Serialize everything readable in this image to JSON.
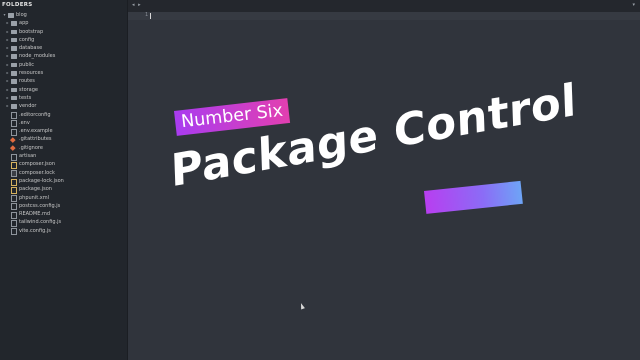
{
  "sidebar": {
    "title": "FOLDERS",
    "items": [
      {
        "label": "blog",
        "type": "folder",
        "arrow": "▾",
        "depth": 0
      },
      {
        "label": "app",
        "type": "folder",
        "arrow": "▸",
        "depth": 1
      },
      {
        "label": "bootstrap",
        "type": "folder",
        "arrow": "▸",
        "depth": 1
      },
      {
        "label": "config",
        "type": "folder",
        "arrow": "▸",
        "depth": 1
      },
      {
        "label": "database",
        "type": "folder",
        "arrow": "▸",
        "depth": 1
      },
      {
        "label": "node_modules",
        "type": "folder",
        "arrow": "▸",
        "depth": 1
      },
      {
        "label": "public",
        "type": "folder",
        "arrow": "▸",
        "depth": 1
      },
      {
        "label": "resources",
        "type": "folder",
        "arrow": "▸",
        "depth": 1
      },
      {
        "label": "routes",
        "type": "folder",
        "arrow": "▸",
        "depth": 1
      },
      {
        "label": "storage",
        "type": "folder",
        "arrow": "▸",
        "depth": 1
      },
      {
        "label": "tests",
        "type": "folder",
        "arrow": "▸",
        "depth": 1
      },
      {
        "label": "vendor",
        "type": "folder",
        "arrow": "▸",
        "depth": 1
      },
      {
        "label": ".editorconfig",
        "type": "file",
        "depth": 1
      },
      {
        "label": ".env",
        "type": "file",
        "depth": 1
      },
      {
        "label": ".env.example",
        "type": "file",
        "depth": 1
      },
      {
        "label": ".gitattributes",
        "type": "git",
        "depth": 1
      },
      {
        "label": ".gitignore",
        "type": "git",
        "depth": 1
      },
      {
        "label": "artisan",
        "type": "file",
        "depth": 1
      },
      {
        "label": "composer.json",
        "type": "json",
        "depth": 1
      },
      {
        "label": "composer.lock",
        "type": "lock",
        "depth": 1
      },
      {
        "label": "package-lock.json",
        "type": "json",
        "depth": 1
      },
      {
        "label": "package.json",
        "type": "json",
        "depth": 1
      },
      {
        "label": "phpunit.xml",
        "type": "file",
        "depth": 1
      },
      {
        "label": "postcss.config.js",
        "type": "file",
        "depth": 1
      },
      {
        "label": "README.md",
        "type": "file",
        "depth": 1
      },
      {
        "label": "tailwind.config.js",
        "type": "file",
        "depth": 1
      },
      {
        "label": "vite.config.js",
        "type": "file",
        "depth": 1
      }
    ]
  },
  "editor": {
    "nav_arrows": "◂ ▸",
    "tab_end": "▾",
    "line_number": "1"
  },
  "promo": {
    "tag": "Number Six",
    "title": "Package Control"
  },
  "colors": {
    "accent_magenta": "#e23fb0",
    "accent_purple": "#a93cf0",
    "accent_blue": "#6ea4f6",
    "editor_bg": "#30343c",
    "sidebar_bg": "#22262c"
  }
}
